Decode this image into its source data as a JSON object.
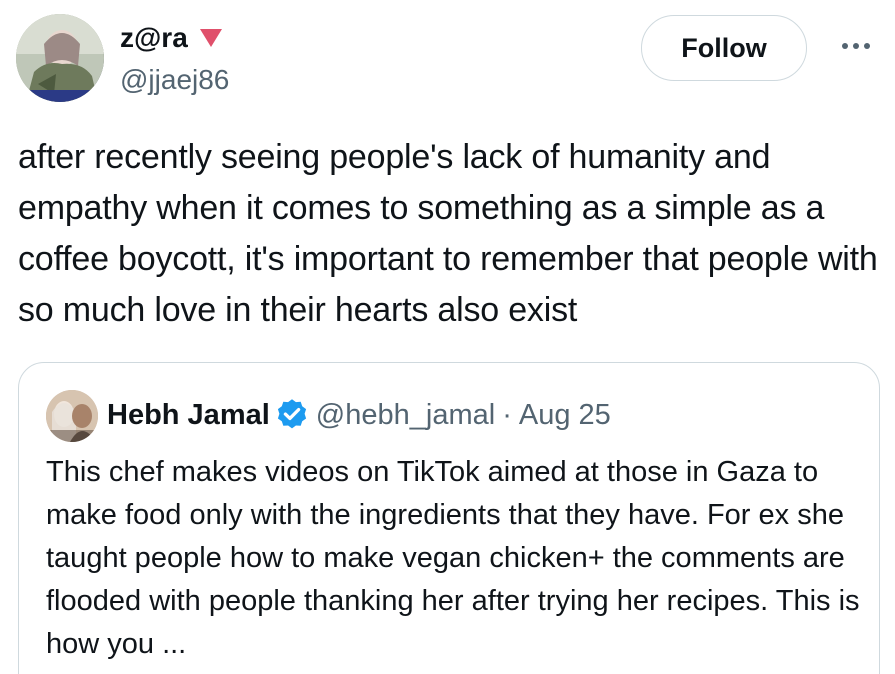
{
  "author": {
    "display_name": "z@ra",
    "handle": "@jjaej86",
    "badge_icon": "heart-icon",
    "badge_color": "#e0506b"
  },
  "follow_button": {
    "label": "Follow"
  },
  "more_button": {
    "icon": "more-icon"
  },
  "tweet": {
    "text": "after recently seeing people's lack of humanity and empathy when it comes to something as a simple as a coffee boycott, it's important to remember that people with so much love in their hearts also exist"
  },
  "quote": {
    "display_name": "Hebh Jamal",
    "verified_icon": "verified-icon",
    "verified_color": "#1d9bf0",
    "handle": "@hebh_jamal",
    "separator": "·",
    "date": "Aug 25",
    "text": "This chef makes videos on TikTok aimed at those in Gaza to make food only with the ingredients that they have. For ex she taught people how to make vegan chicken+ the comments are flooded with people thanking her after trying her recipes. This is how you ..."
  }
}
